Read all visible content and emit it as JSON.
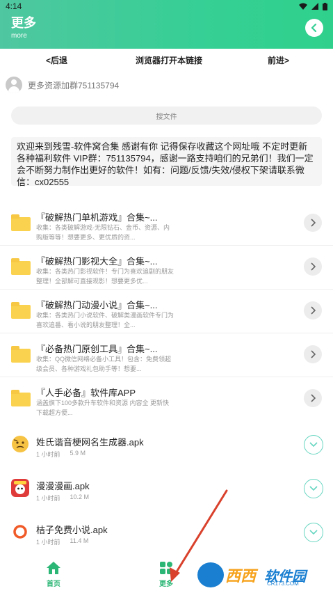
{
  "status": {
    "time": "4:14"
  },
  "header": {
    "title": "更多",
    "subtitle": "more"
  },
  "nav": {
    "back": "<后退",
    "open_in_browser": "浏览器打开本链接",
    "forward": "前进>"
  },
  "info": {
    "text": "更多资源加群751135794"
  },
  "search": {
    "placeholder": "搜文件"
  },
  "notice": {
    "text": "欢迎来到残雪-软件窝合集 感谢有你 记得保存收藏这个网址哦 不定时更新各种福利软件 VIP群：751135794，感谢一路支持咱们的兄弟们！我们一定会不断努力制作出更好的软件！如有：问题/反馈/失效/侵权下架请联系微信：cx02555"
  },
  "folders": [
    {
      "title": "『破解热门单机游戏』合集~...",
      "desc": "收集：各类破解游戏-无限钻石、金币、资源、内购版等等！想要更多、更优质的资..."
    },
    {
      "title": "『破解热门影视大全』合集~...",
      "desc": "收集：各类热门影视软件！专门为喜欢追剧的朋友整理！全部解可直接观影！想要更多优..."
    },
    {
      "title": "『破解热门动漫小说』合集~...",
      "desc": "收集：各类热门小说软件、破解类漫画软件专门为喜欢追番、看小说的朋友整理！全..."
    },
    {
      "title": "『必备热门原创工具』合集~...",
      "desc": "收集：QQ微信网络必备小工具！包含：免费领超级会员、各种游戏礼包助手等！想要..."
    },
    {
      "title": "『人手必备』软件库APP",
      "desc": "涵盖旗下100多款升车软件和资源 内容全 更新快 下载超方便..."
    }
  ],
  "apps": [
    {
      "title": "姓氏谐音梗网名生成器.apk",
      "time": "1 小时前",
      "size": "5.9 M"
    },
    {
      "title": "漫漫漫画.apk",
      "time": "1 小时前",
      "size": "10.2 M"
    },
    {
      "title": "桔子免费小说.apk",
      "time": "1 小时前",
      "size": "11.4 M"
    }
  ],
  "tabbar": {
    "home": "首页",
    "more": "更多"
  },
  "watermark": {
    "brand": "西西",
    "name": "软件园",
    "domain": "CR173.COM"
  },
  "colors": {
    "accent": "#2fd08c",
    "folder": "#fbd24f",
    "annotation": "#d9412c"
  }
}
